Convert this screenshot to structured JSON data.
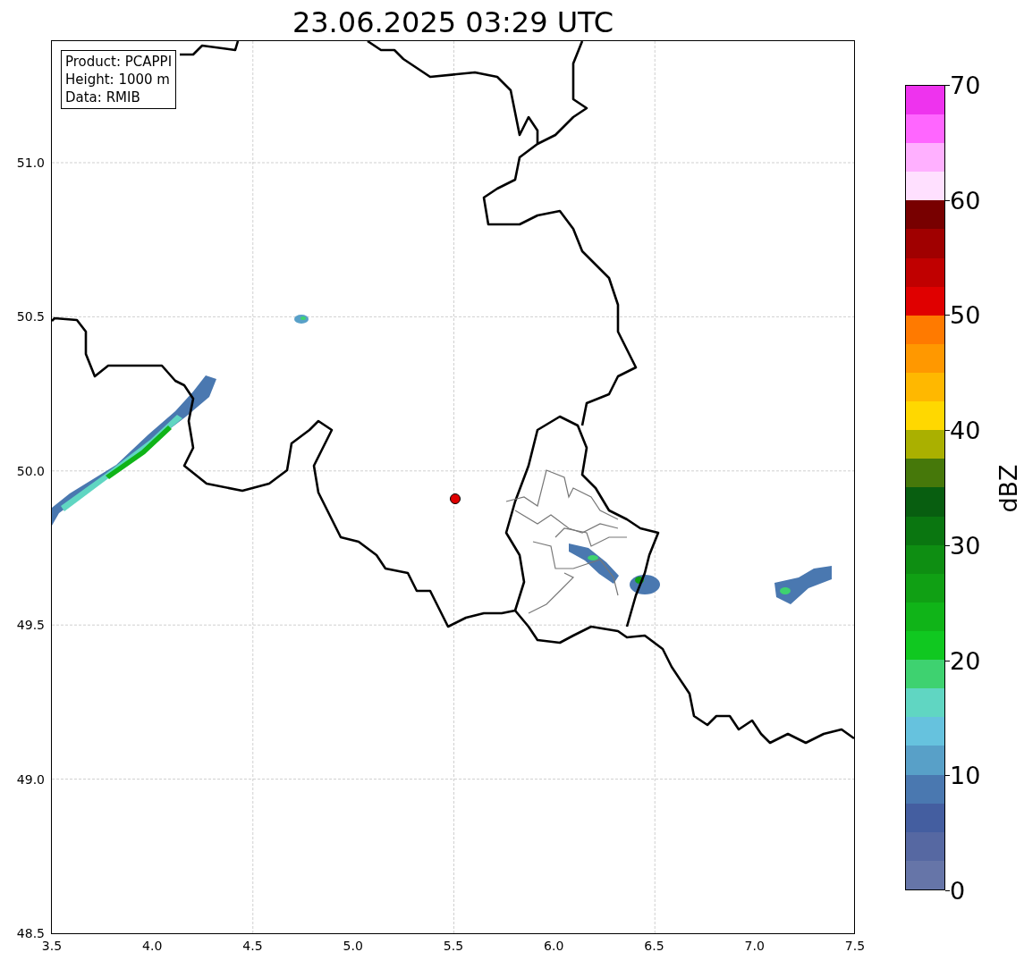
{
  "title": "23.06.2025 03:29 UTC",
  "info_box": [
    "Product: PCAPPI",
    "Height: 1000 m",
    "Data: RMIB"
  ],
  "x_ticks": [
    "3.5",
    "4.0",
    "4.5",
    "5.0",
    "5.5",
    "6.0",
    "6.5",
    "7.0",
    "7.5"
  ],
  "y_ticks": [
    "51.0",
    "50.5",
    "50.0",
    "49.5",
    "49.0",
    "48.5"
  ],
  "colorbar": {
    "label": "dBZ",
    "ticks": [
      "70",
      "60",
      "50",
      "40",
      "30",
      "20",
      "10",
      "0"
    ],
    "bins": [
      {
        "color": "#6675a8"
      },
      {
        "color": "#5668a2"
      },
      {
        "color": "#445ea0"
      },
      {
        "color": "#4a78b0"
      },
      {
        "color": "#58a0c8"
      },
      {
        "color": "#66c2de"
      },
      {
        "color": "#60d6c2"
      },
      {
        "color": "#3ed270"
      },
      {
        "color": "#10c820"
      },
      {
        "color": "#10b418"
      },
      {
        "color": "#10a014"
      },
      {
        "color": "#0e8e12"
      },
      {
        "color": "#0a7610"
      },
      {
        "color": "#085e10"
      },
      {
        "color": "#46780a"
      },
      {
        "color": "#aab000"
      },
      {
        "color": "#ffd800"
      },
      {
        "color": "#ffb800"
      },
      {
        "color": "#ff9800"
      },
      {
        "color": "#ff7a00"
      },
      {
        "color": "#e00000"
      },
      {
        "color": "#c00000"
      },
      {
        "color": "#a00000"
      },
      {
        "color": "#780000"
      },
      {
        "color": "#ffe0ff"
      },
      {
        "color": "#ffb0ff"
      },
      {
        "color": "#ff66ff"
      },
      {
        "color": "#ee33ee"
      }
    ]
  }
}
